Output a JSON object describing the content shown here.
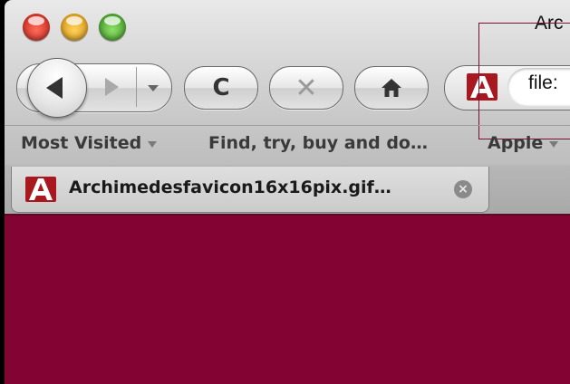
{
  "window": {
    "title": "Arc"
  },
  "toolbar": {
    "back_icon": "back-arrow-icon",
    "forward_icon": "forward-arrow-icon",
    "history_icon": "chevron-down-icon",
    "reload_glyph": "C",
    "stop_glyph": "✕",
    "home_icon": "home-icon"
  },
  "urlbar": {
    "site_icon": "archimedes-a-icon",
    "url": "file:"
  },
  "bookmarks": [
    {
      "label": "Most Visited",
      "has_menu": true
    },
    {
      "label": "Find, try, buy and do…",
      "has_menu": false
    },
    {
      "label": "Apple",
      "has_menu": true
    }
  ],
  "tab": {
    "title": "Archimedesfavicon16x16pix.gif…",
    "icon": "archimedes-a-icon"
  },
  "colors": {
    "content_background": "#830333",
    "favicon_red": "#a8181e"
  }
}
